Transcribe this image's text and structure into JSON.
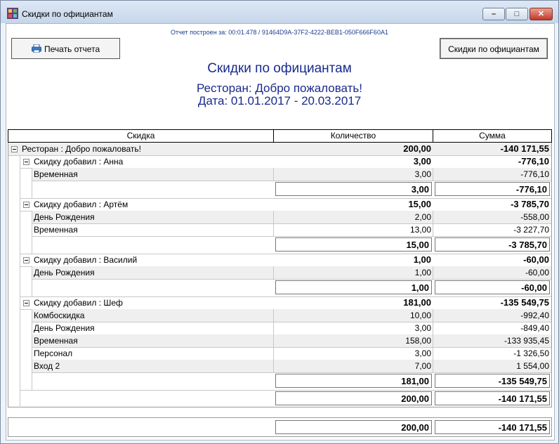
{
  "window": {
    "title": "Скидки по официантам",
    "icon": "app-grid-icon",
    "buttons": {
      "minimize": "–",
      "maximize": "□",
      "close": "✕"
    }
  },
  "report": {
    "meta": "Отчет построен за: 00:01.478 / 91464D9A-37F2-4222-BEB1-050F666F60A1",
    "print_button": "Печать отчета",
    "view_button": "Скидки по официантам",
    "title": "Скидки по официантам",
    "restaurant_line": "Ресторан: Добро пожаловать!",
    "date_line": "Дата: 01.01.2017 - 20.03.2017"
  },
  "table": {
    "headers": {
      "discount": "Скидка",
      "quantity": "Количество",
      "sum": "Сумма"
    },
    "restaurant": {
      "label": "Ресторан : Добро пожаловать!",
      "quantity": "200,00",
      "sum": "-140 171,55"
    },
    "groups": [
      {
        "label": "Скидку добавил : Анна",
        "quantity": "3,00",
        "sum": "-776,10",
        "rows": [
          {
            "name": "Временная",
            "quantity": "3,00",
            "sum": "-776,10"
          }
        ],
        "total_quantity": "3,00",
        "total_sum": "-776,10"
      },
      {
        "label": "Скидку добавил : Артём",
        "quantity": "15,00",
        "sum": "-3 785,70",
        "rows": [
          {
            "name": "День Рождения",
            "quantity": "2,00",
            "sum": "-558,00"
          },
          {
            "name": "Временная",
            "quantity": "13,00",
            "sum": "-3 227,70"
          }
        ],
        "total_quantity": "15,00",
        "total_sum": "-3 785,70"
      },
      {
        "label": "Скидку добавил : Василий",
        "quantity": "1,00",
        "sum": "-60,00",
        "rows": [
          {
            "name": "День Рождения",
            "quantity": "1,00",
            "sum": "-60,00"
          }
        ],
        "total_quantity": "1,00",
        "total_sum": "-60,00"
      },
      {
        "label": "Скидку добавил : Шеф",
        "quantity": "181,00",
        "sum": "-135 549,75",
        "rows": [
          {
            "name": "Комбоскидка",
            "quantity": "10,00",
            "sum": "-992,40"
          },
          {
            "name": "День Рождения",
            "quantity": "3,00",
            "sum": "-849,40"
          },
          {
            "name": "Временная",
            "quantity": "158,00",
            "sum": "-133 935,45"
          },
          {
            "name": "Персонал",
            "quantity": "3,00",
            "sum": "-1 326,50"
          },
          {
            "name": "Вход 2",
            "quantity": "7,00",
            "sum": "1 554,00"
          }
        ],
        "total_quantity": "181,00",
        "total_sum": "-135 549,75"
      }
    ],
    "restaurant_total": {
      "quantity": "200,00",
      "sum": "-140 171,55"
    },
    "grand_total": {
      "quantity": "200,00",
      "sum": "-140 171,55"
    }
  }
}
